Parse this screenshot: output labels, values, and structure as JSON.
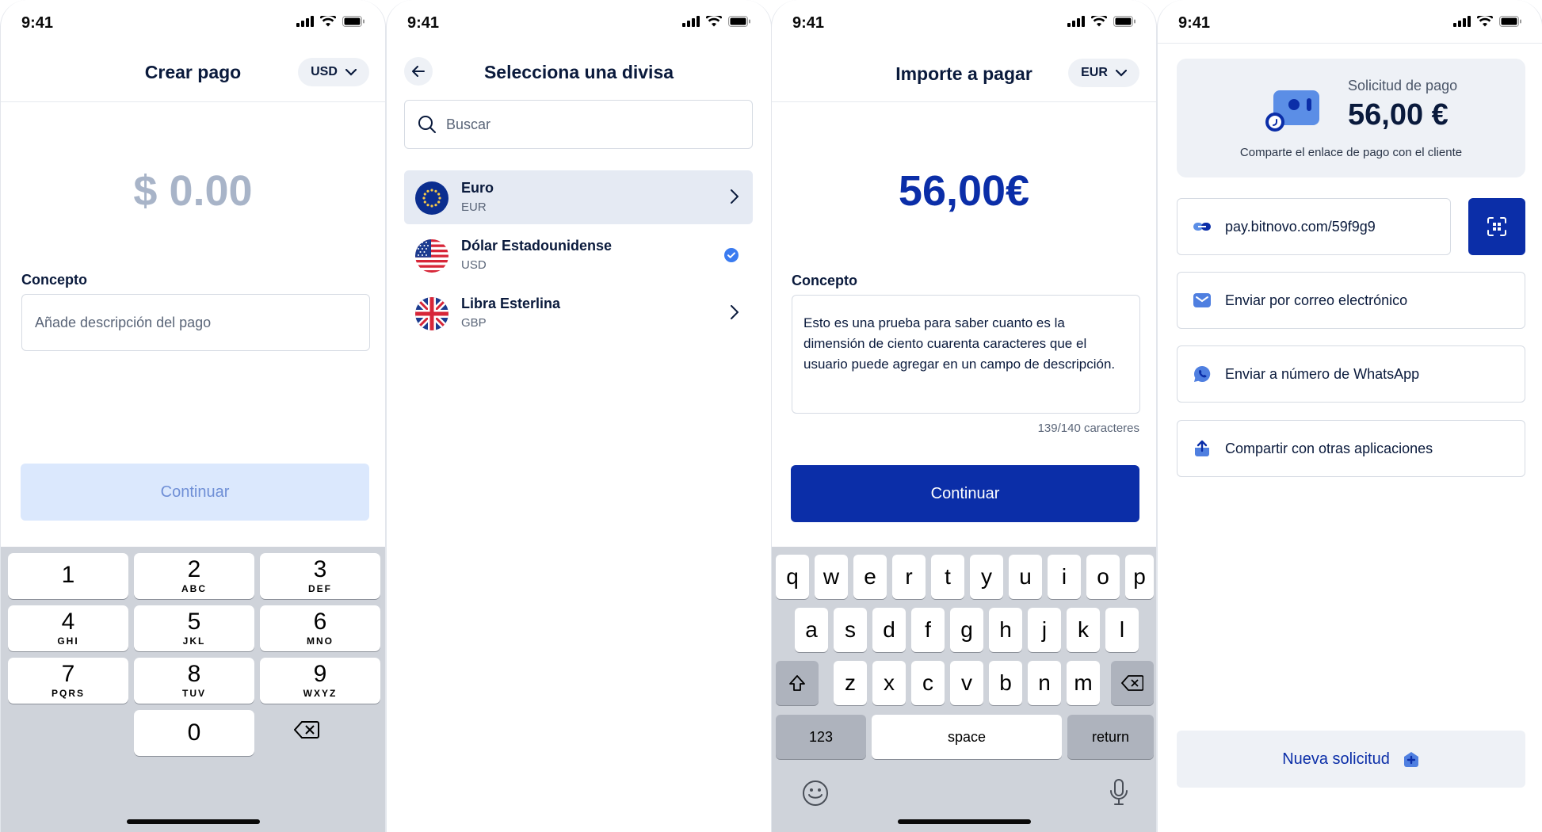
{
  "status": {
    "time": "9:41"
  },
  "screen1": {
    "title": "Crear pago",
    "currency": "USD",
    "amount": "$ 0.00",
    "concept_label": "Concepto",
    "concept_placeholder": "Añade descripción del pago",
    "continue_label": "Continuar",
    "keys": [
      {
        "digit": "1",
        "letters": ""
      },
      {
        "digit": "2",
        "letters": "ABC"
      },
      {
        "digit": "3",
        "letters": "DEF"
      },
      {
        "digit": "4",
        "letters": "GHI"
      },
      {
        "digit": "5",
        "letters": "JKL"
      },
      {
        "digit": "6",
        "letters": "MNO"
      },
      {
        "digit": "7",
        "letters": "PQRS"
      },
      {
        "digit": "8",
        "letters": "TUV"
      },
      {
        "digit": "9",
        "letters": "WXYZ"
      },
      {
        "digit": "0",
        "letters": ""
      }
    ]
  },
  "screen2": {
    "title": "Selecciona una divisa",
    "search_placeholder": "Buscar",
    "currencies": [
      {
        "name": "Euro",
        "code": "EUR",
        "state": "highlighted"
      },
      {
        "name": "Dólar Estadounidense",
        "code": "USD",
        "state": "selected"
      },
      {
        "name": "Libra Esterlina",
        "code": "GBP",
        "state": "default"
      }
    ]
  },
  "screen3": {
    "title": "Importe a pagar",
    "currency": "EUR",
    "amount": "56,00€",
    "concept_label": "Concepto",
    "concept_text": "Esto es una prueba para saber cuanto es la dimensión de ciento cuarenta caracteres que el usuario puede agregar en un campo de descripción.",
    "char_count": "139/140 caracteres",
    "continue_label": "Continuar",
    "keyboard": {
      "row1": [
        "q",
        "w",
        "e",
        "r",
        "t",
        "y",
        "u",
        "i",
        "o",
        "p"
      ],
      "row2": [
        "a",
        "s",
        "d",
        "f",
        "g",
        "h",
        "j",
        "k",
        "l"
      ],
      "row3": [
        "z",
        "x",
        "c",
        "v",
        "b",
        "n",
        "m"
      ],
      "numbers_key": "123",
      "space_key": "space",
      "return_key": "return"
    }
  },
  "screen4": {
    "request_label": "Solicitud de pago",
    "request_amount": "56,00 €",
    "request_sub": "Comparte el enlace de pago con el cliente",
    "link": "pay.bitnovo.com/59f9g9",
    "actions": [
      {
        "label": "Enviar por correo electrónico",
        "icon": "mail-icon"
      },
      {
        "label": "Enviar a número de WhatsApp",
        "icon": "whatsapp-icon"
      },
      {
        "label": "Compartir con otras aplicaciones",
        "icon": "share-icon"
      }
    ],
    "new_request_label": "Nueva solicitud"
  },
  "colors": {
    "primary": "#0b2ea8",
    "disabled_button": "#dbe8fd",
    "muted_amount": "#a8b4c8",
    "text_dark": "#0a1a3c",
    "keyboard_bg": "#cfd3da"
  }
}
